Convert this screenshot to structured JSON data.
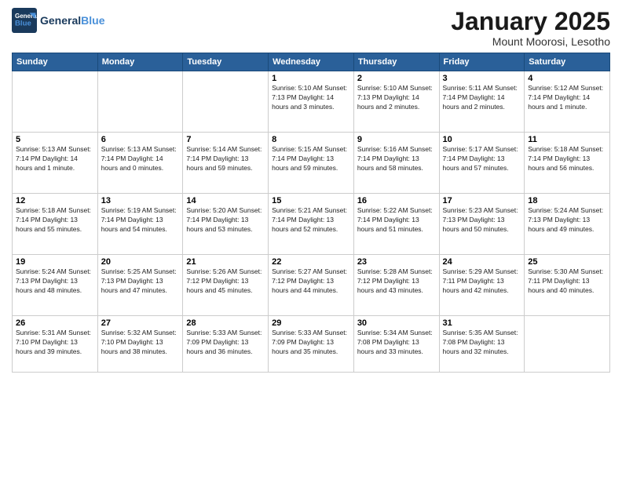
{
  "header": {
    "logo_line1": "General",
    "logo_line2": "Blue",
    "month_year": "January 2025",
    "location": "Mount Moorosi, Lesotho"
  },
  "days_of_week": [
    "Sunday",
    "Monday",
    "Tuesday",
    "Wednesday",
    "Thursday",
    "Friday",
    "Saturday"
  ],
  "weeks": [
    [
      {
        "day": "",
        "info": ""
      },
      {
        "day": "",
        "info": ""
      },
      {
        "day": "",
        "info": ""
      },
      {
        "day": "1",
        "info": "Sunrise: 5:10 AM\nSunset: 7:13 PM\nDaylight: 14 hours\nand 3 minutes."
      },
      {
        "day": "2",
        "info": "Sunrise: 5:10 AM\nSunset: 7:13 PM\nDaylight: 14 hours\nand 2 minutes."
      },
      {
        "day": "3",
        "info": "Sunrise: 5:11 AM\nSunset: 7:14 PM\nDaylight: 14 hours\nand 2 minutes."
      },
      {
        "day": "4",
        "info": "Sunrise: 5:12 AM\nSunset: 7:14 PM\nDaylight: 14 hours\nand 1 minute."
      }
    ],
    [
      {
        "day": "5",
        "info": "Sunrise: 5:13 AM\nSunset: 7:14 PM\nDaylight: 14 hours\nand 1 minute."
      },
      {
        "day": "6",
        "info": "Sunrise: 5:13 AM\nSunset: 7:14 PM\nDaylight: 14 hours\nand 0 minutes."
      },
      {
        "day": "7",
        "info": "Sunrise: 5:14 AM\nSunset: 7:14 PM\nDaylight: 13 hours\nand 59 minutes."
      },
      {
        "day": "8",
        "info": "Sunrise: 5:15 AM\nSunset: 7:14 PM\nDaylight: 13 hours\nand 59 minutes."
      },
      {
        "day": "9",
        "info": "Sunrise: 5:16 AM\nSunset: 7:14 PM\nDaylight: 13 hours\nand 58 minutes."
      },
      {
        "day": "10",
        "info": "Sunrise: 5:17 AM\nSunset: 7:14 PM\nDaylight: 13 hours\nand 57 minutes."
      },
      {
        "day": "11",
        "info": "Sunrise: 5:18 AM\nSunset: 7:14 PM\nDaylight: 13 hours\nand 56 minutes."
      }
    ],
    [
      {
        "day": "12",
        "info": "Sunrise: 5:18 AM\nSunset: 7:14 PM\nDaylight: 13 hours\nand 55 minutes."
      },
      {
        "day": "13",
        "info": "Sunrise: 5:19 AM\nSunset: 7:14 PM\nDaylight: 13 hours\nand 54 minutes."
      },
      {
        "day": "14",
        "info": "Sunrise: 5:20 AM\nSunset: 7:14 PM\nDaylight: 13 hours\nand 53 minutes."
      },
      {
        "day": "15",
        "info": "Sunrise: 5:21 AM\nSunset: 7:14 PM\nDaylight: 13 hours\nand 52 minutes."
      },
      {
        "day": "16",
        "info": "Sunrise: 5:22 AM\nSunset: 7:14 PM\nDaylight: 13 hours\nand 51 minutes."
      },
      {
        "day": "17",
        "info": "Sunrise: 5:23 AM\nSunset: 7:13 PM\nDaylight: 13 hours\nand 50 minutes."
      },
      {
        "day": "18",
        "info": "Sunrise: 5:24 AM\nSunset: 7:13 PM\nDaylight: 13 hours\nand 49 minutes."
      }
    ],
    [
      {
        "day": "19",
        "info": "Sunrise: 5:24 AM\nSunset: 7:13 PM\nDaylight: 13 hours\nand 48 minutes."
      },
      {
        "day": "20",
        "info": "Sunrise: 5:25 AM\nSunset: 7:13 PM\nDaylight: 13 hours\nand 47 minutes."
      },
      {
        "day": "21",
        "info": "Sunrise: 5:26 AM\nSunset: 7:12 PM\nDaylight: 13 hours\nand 45 minutes."
      },
      {
        "day": "22",
        "info": "Sunrise: 5:27 AM\nSunset: 7:12 PM\nDaylight: 13 hours\nand 44 minutes."
      },
      {
        "day": "23",
        "info": "Sunrise: 5:28 AM\nSunset: 7:12 PM\nDaylight: 13 hours\nand 43 minutes."
      },
      {
        "day": "24",
        "info": "Sunrise: 5:29 AM\nSunset: 7:11 PM\nDaylight: 13 hours\nand 42 minutes."
      },
      {
        "day": "25",
        "info": "Sunrise: 5:30 AM\nSunset: 7:11 PM\nDaylight: 13 hours\nand 40 minutes."
      }
    ],
    [
      {
        "day": "26",
        "info": "Sunrise: 5:31 AM\nSunset: 7:10 PM\nDaylight: 13 hours\nand 39 minutes."
      },
      {
        "day": "27",
        "info": "Sunrise: 5:32 AM\nSunset: 7:10 PM\nDaylight: 13 hours\nand 38 minutes."
      },
      {
        "day": "28",
        "info": "Sunrise: 5:33 AM\nSunset: 7:09 PM\nDaylight: 13 hours\nand 36 minutes."
      },
      {
        "day": "29",
        "info": "Sunrise: 5:33 AM\nSunset: 7:09 PM\nDaylight: 13 hours\nand 35 minutes."
      },
      {
        "day": "30",
        "info": "Sunrise: 5:34 AM\nSunset: 7:08 PM\nDaylight: 13 hours\nand 33 minutes."
      },
      {
        "day": "31",
        "info": "Sunrise: 5:35 AM\nSunset: 7:08 PM\nDaylight: 13 hours\nand 32 minutes."
      },
      {
        "day": "",
        "info": ""
      }
    ]
  ]
}
